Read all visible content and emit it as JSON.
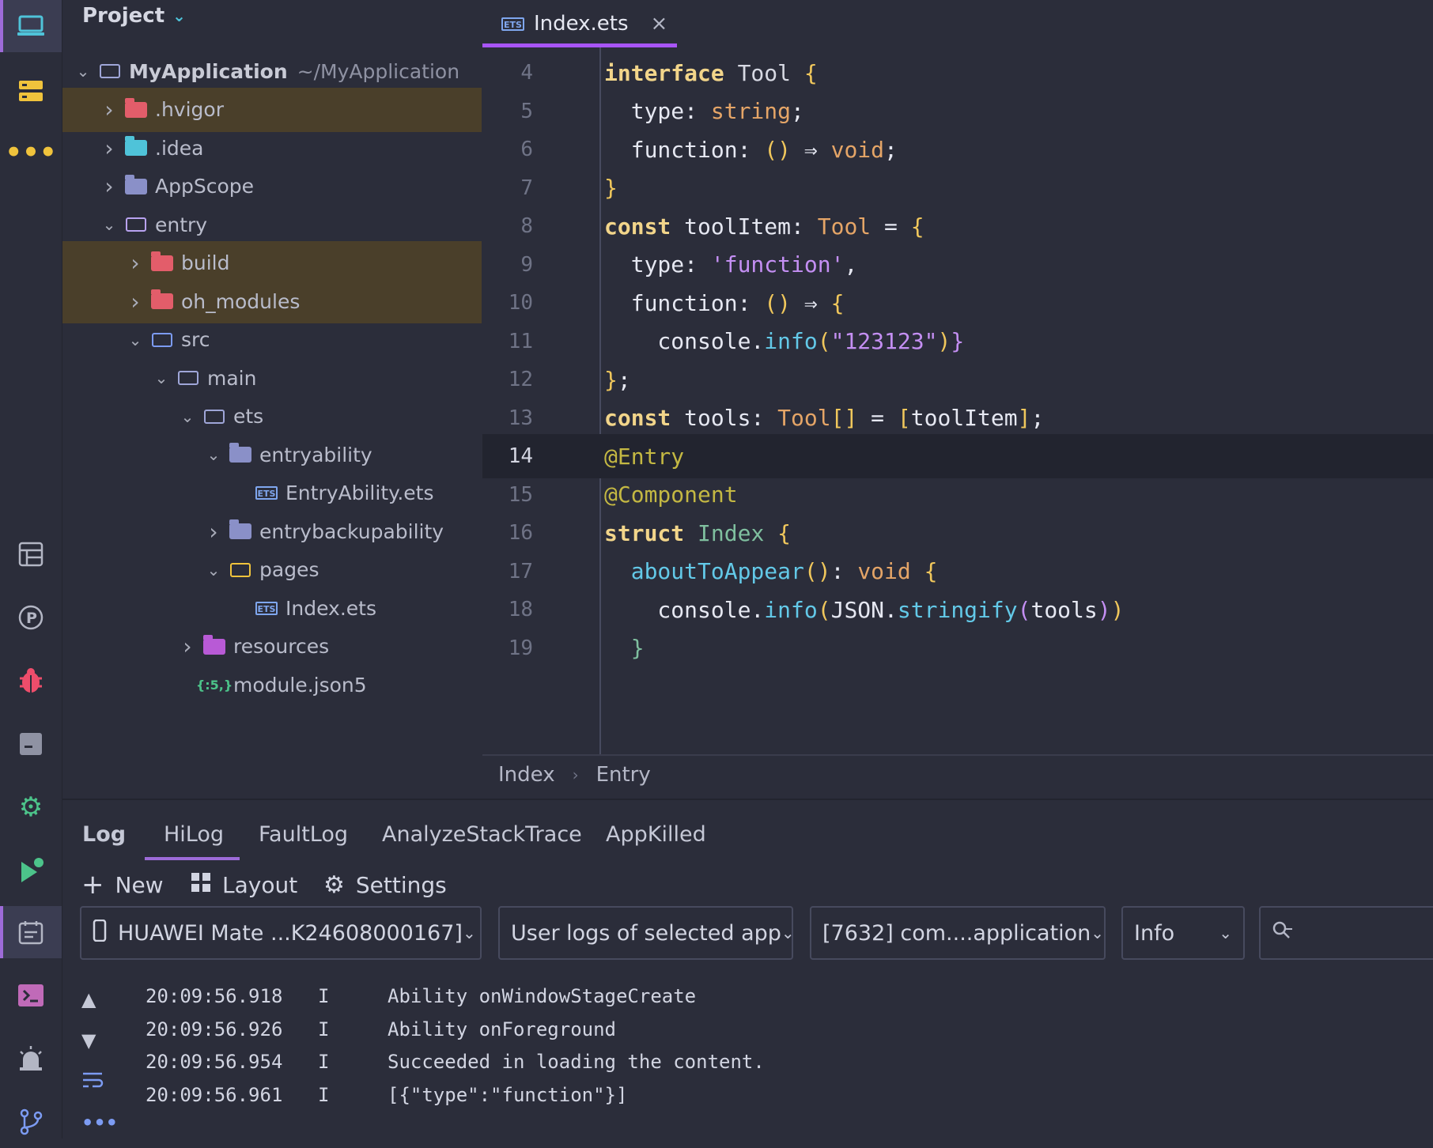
{
  "project_panel": {
    "title": "Project",
    "tree": [
      {
        "label": "MyApplication",
        "suffix": "~/MyApplication",
        "depth": 0,
        "expanded": true,
        "icon": "folder-outline-icon"
      },
      {
        "label": ".hvigor",
        "depth": 1,
        "expanded": false,
        "icon": "excluded-folder-icon",
        "highlight": true
      },
      {
        "label": ".idea",
        "depth": 1,
        "expanded": false,
        "icon": "idea-folder-icon"
      },
      {
        "label": "AppScope",
        "depth": 1,
        "expanded": false,
        "icon": "folder-icon"
      },
      {
        "label": "entry",
        "depth": 1,
        "expanded": true,
        "icon": "module-folder-icon"
      },
      {
        "label": "build",
        "depth": 2,
        "expanded": false,
        "icon": "excluded-folder-icon",
        "highlight": true
      },
      {
        "label": "oh_modules",
        "depth": 2,
        "expanded": false,
        "icon": "excluded-folder-icon",
        "highlight": true
      },
      {
        "label": "src",
        "depth": 2,
        "expanded": true,
        "icon": "source-folder-icon"
      },
      {
        "label": "main",
        "depth": 3,
        "expanded": true,
        "icon": "main-folder-icon"
      },
      {
        "label": "ets",
        "depth": 4,
        "expanded": true,
        "icon": "folder-outline-icon"
      },
      {
        "label": "entryability",
        "depth": 5,
        "expanded": true,
        "icon": "folder-icon"
      },
      {
        "label": "EntryAbility.ets",
        "depth": 6,
        "icon": "ets-file-icon"
      },
      {
        "label": "entrybackupability",
        "depth": 5,
        "expanded": false,
        "icon": "folder-icon"
      },
      {
        "label": "pages",
        "depth": 5,
        "expanded": true,
        "icon": "pages-folder-icon"
      },
      {
        "label": "Index.ets",
        "depth": 6,
        "icon": "ets-file-icon"
      },
      {
        "label": "resources",
        "depth": 4,
        "expanded": false,
        "icon": "resources-folder-icon"
      },
      {
        "label": "module.json5",
        "depth": 4,
        "icon": "json5-file-icon"
      }
    ]
  },
  "editor": {
    "tab_label": "Index.ets",
    "tab_close": "×",
    "line_numbers": [
      "4",
      "5",
      "6",
      "7",
      "8",
      "9",
      "10",
      "11",
      "12",
      "13",
      "14",
      "15",
      "16",
      "17",
      "18",
      "19"
    ],
    "current_line": "14",
    "breadcrumb": [
      "Index",
      "Entry"
    ],
    "breadcrumb_sep": "›"
  },
  "log_panel": {
    "tabs": [
      "Log",
      "HiLog",
      "FaultLog",
      "AnalyzeStackTrace",
      "AppKilled"
    ],
    "active_tab": "HiLog",
    "toolbar": {
      "new": "New",
      "layout": "Layout",
      "settings": "Settings"
    },
    "device": "HUAWEI Mate ...K24608000167]",
    "filter_scope": "User logs of selected app",
    "process": "[7632] com....application",
    "level": "Info",
    "search_placeholder": "",
    "entries": [
      {
        "time": "20:09:56.918",
        "level": "I",
        "message": "Ability onWindowStageCreate"
      },
      {
        "time": "20:09:56.926",
        "level": "I",
        "message": "Ability onForeground"
      },
      {
        "time": "20:09:56.954",
        "level": "I",
        "message": "Succeeded in loading the content."
      },
      {
        "time": "20:09:56.961",
        "level": "I",
        "message": "[{\"type\":\"function\"}]"
      }
    ]
  },
  "colors": {
    "background": "#2b2d3a",
    "accent": "#a855f7",
    "excluded_highlight": "#4a3f2a",
    "keyword": "#f2d58a",
    "string": "#c48ff3",
    "function": "#63c9e8"
  }
}
